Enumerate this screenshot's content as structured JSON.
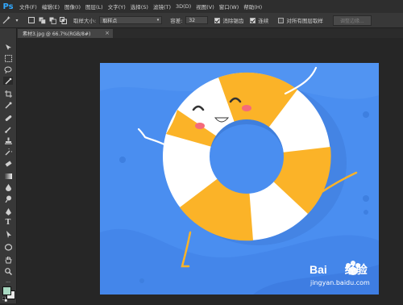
{
  "app": {
    "logo": "Ps"
  },
  "menu": [
    "文件(F)",
    "编辑(E)",
    "图像(I)",
    "图层(L)",
    "文字(Y)",
    "选择(S)",
    "滤镜(T)",
    "3D(D)",
    "视图(V)",
    "窗口(W)",
    "帮助(H)"
  ],
  "options": {
    "sample_size_label": "取样大小:",
    "sample_size_value": "取样点",
    "tolerance_label": "容差:",
    "tolerance_value": "32",
    "anti_alias_label": "消除锯齿",
    "anti_alias_checked": true,
    "contiguous_label": "连续",
    "contiguous_checked": true,
    "all_layers_label": "对所有图层取样",
    "all_layers_checked": false,
    "refine_edge_label": "调整边缘..."
  },
  "document": {
    "tab_label": "素材3.jpg @ 66.7%(RGB/8#)",
    "close_glyph": "×"
  },
  "tools": [
    "move-tool",
    "marquee-tool",
    "lasso-tool",
    "magic-wand-tool",
    "crop-tool",
    "eyedropper-tool",
    "healing-brush-tool",
    "brush-tool",
    "clone-stamp-tool",
    "history-brush-tool",
    "eraser-tool",
    "gradient-tool",
    "blur-tool",
    "dodge-tool",
    "pen-tool",
    "type-tool",
    "path-selection-tool",
    "shape-tool",
    "hand-tool",
    "zoom-tool"
  ],
  "colors": {
    "foreground": "#a9d9c2",
    "background": "#e9e9e9",
    "canvas_blue": "#4a8ef0",
    "ring_orange": "#fbb328",
    "ring_white": "#ffffff"
  },
  "watermark": {
    "brand": "Bai",
    "brand2": "经验",
    "url": "jingyan.baidu.com"
  }
}
